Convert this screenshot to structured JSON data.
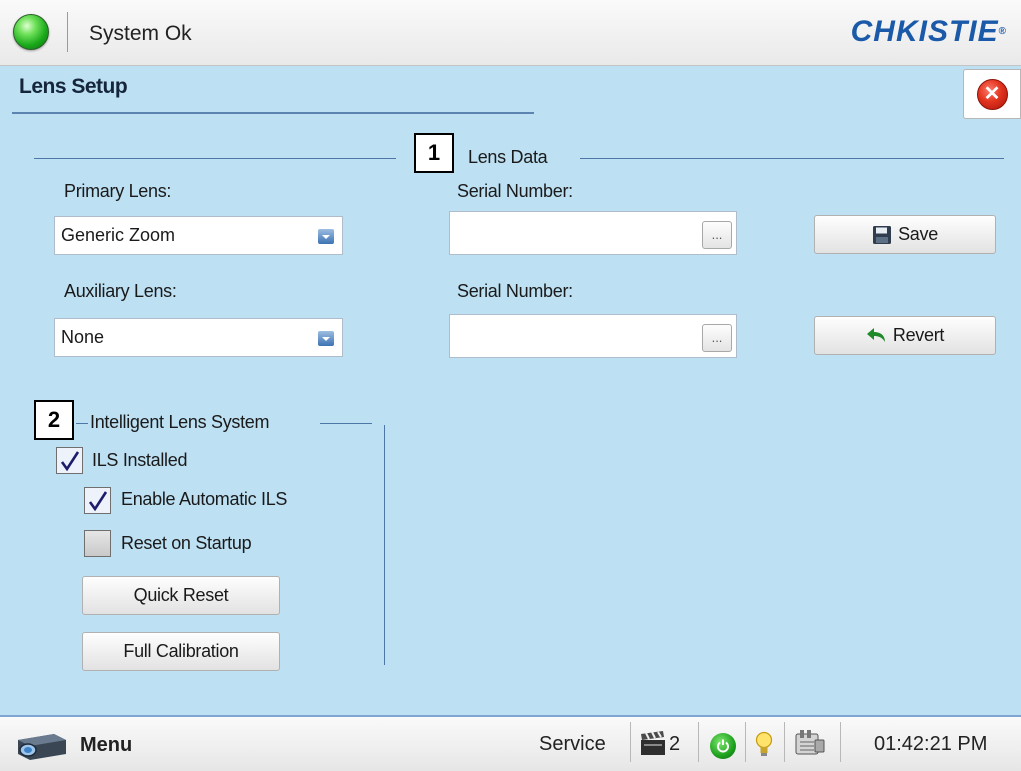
{
  "header": {
    "status_text": "System Ok",
    "status_color": "#2fbf2f",
    "logo_text": "CHKISTIE",
    "logo_mark": "®"
  },
  "page": {
    "title": "Lens Setup",
    "close_icon": "close-icon"
  },
  "lens_data": {
    "marker": "1",
    "section_title": "Lens Data",
    "primary_label": "Primary Lens:",
    "primary_value": "Generic Zoom",
    "primary_serial_label": "Serial Number:",
    "primary_serial_value": "",
    "auxiliary_label": "Auxiliary Lens:",
    "auxiliary_value": "None",
    "auxiliary_serial_label": "Serial Number:",
    "auxiliary_serial_value": "",
    "browse_label": "...",
    "save_label": "Save",
    "revert_label": "Revert"
  },
  "ils": {
    "marker": "2",
    "section_title": "Intelligent Lens System",
    "installed_label": "ILS Installed",
    "installed_checked": true,
    "auto_label": "Enable Automatic ILS",
    "auto_checked": true,
    "reset_startup_label": "Reset on Startup",
    "reset_startup_checked": false,
    "quick_reset_label": "Quick Reset",
    "full_calibration_label": "Full Calibration"
  },
  "footer": {
    "menu_label": "Menu",
    "mode_label": "Service",
    "channel_count": "2",
    "time": "01:42:21 PM"
  },
  "colors": {
    "panel_bg": "#bde0f3",
    "accent_line": "#4d77a6",
    "logo": "#1b5aa8"
  }
}
